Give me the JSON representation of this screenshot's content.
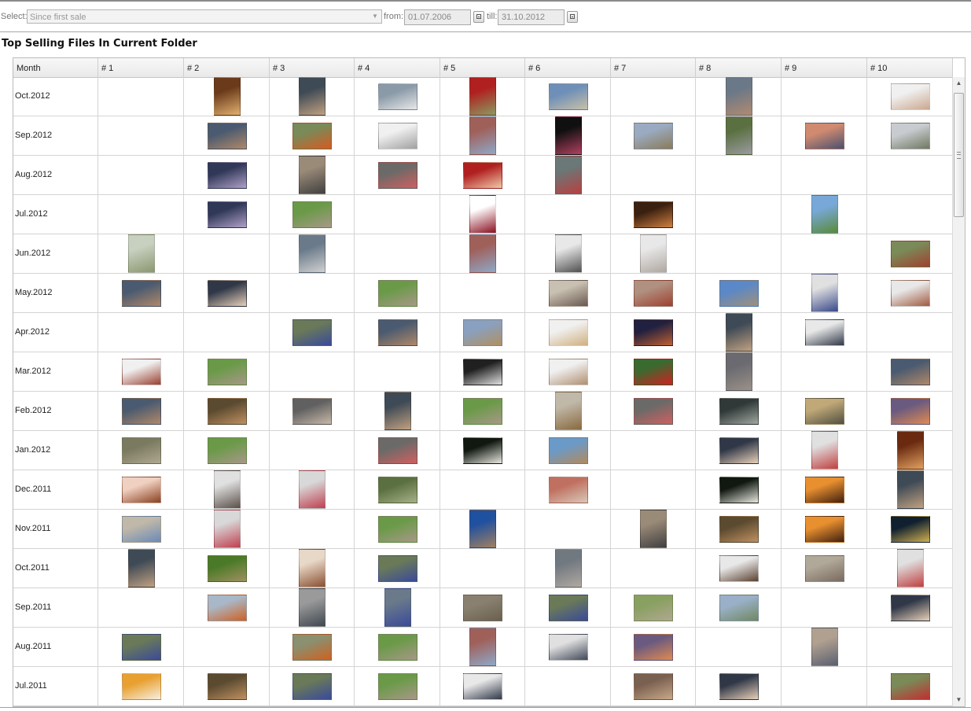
{
  "toolbar": {
    "select_label": "Select:",
    "period_value": "Since first sale",
    "from_label": "from:",
    "from_value": "01.07.2006",
    "till_label": "till:",
    "till_value": "31.10.2012"
  },
  "panel": {
    "title": "Top Selling Files In Current Folder"
  },
  "columns": [
    "Month",
    "# 1",
    "# 2",
    "# 3",
    "# 4",
    "# 5",
    "# 6",
    "# 7",
    "# 8",
    "# 9",
    "# 10"
  ],
  "rows": [
    {
      "month": "Oct.2012",
      "cells": [
        null,
        {
          "o": "p",
          "c": [
            "#6b3a1a",
            "#e0b070"
          ]
        },
        {
          "o": "p",
          "c": [
            "#3e4a55",
            "#c0a080"
          ]
        },
        {
          "o": "l",
          "c": [
            "#8a9aa8",
            "#e8e8e8"
          ]
        },
        {
          "o": "p",
          "c": [
            "#b02020",
            "#8a9a60"
          ]
        },
        {
          "o": "l",
          "c": [
            "#6e8fb8",
            "#c8c0a8"
          ]
        },
        null,
        {
          "o": "p",
          "c": [
            "#6a7888",
            "#b08a70"
          ]
        },
        null,
        {
          "o": "l",
          "c": [
            "#f0f0f0",
            "#caa890"
          ]
        }
      ]
    },
    {
      "month": "Sep.2012",
      "cells": [
        null,
        {
          "o": "l",
          "c": [
            "#4a5a70",
            "#b08868"
          ]
        },
        {
          "o": "l",
          "c": [
            "#7a8a58",
            "#d85a20"
          ]
        },
        {
          "o": "l",
          "c": [
            "#f0f0f0",
            "#a0a0a0"
          ]
        },
        {
          "o": "p",
          "c": [
            "#a0605a",
            "#8fa8c8"
          ]
        },
        {
          "o": "p",
          "c": [
            "#101010",
            "#b04060"
          ]
        },
        {
          "o": "l",
          "c": [
            "#9aaac0",
            "#8a7a58"
          ]
        },
        {
          "o": "p",
          "c": [
            "#5a7040",
            "#9a9aa0"
          ]
        },
        {
          "o": "l",
          "c": [
            "#d08a70",
            "#4a5070"
          ]
        },
        {
          "o": "l",
          "c": [
            "#c8ccd0",
            "#707860"
          ]
        }
      ]
    },
    {
      "month": "Aug.2012",
      "cells": [
        null,
        {
          "o": "l",
          "c": [
            "#303858",
            "#b0a0c8"
          ]
        },
        {
          "o": "p",
          "c": [
            "#9a8a78",
            "#404040"
          ]
        },
        {
          "o": "l",
          "c": [
            "#6a6a68",
            "#d06060"
          ]
        },
        {
          "o": "l",
          "c": [
            "#b02020",
            "#f0c8a8"
          ]
        },
        {
          "o": "p",
          "c": [
            "#6a7878",
            "#b84040"
          ]
        },
        null,
        null,
        null,
        null
      ]
    },
    {
      "month": "Jul.2012",
      "cells": [
        null,
        {
          "o": "l",
          "c": [
            "#303858",
            "#b0a0c8"
          ]
        },
        {
          "o": "l",
          "c": [
            "#6a9a48",
            "#a89888"
          ]
        },
        null,
        {
          "o": "p",
          "c": [
            "#ffffff",
            "#8a1020"
          ]
        },
        null,
        {
          "o": "l",
          "c": [
            "#3a2010",
            "#d08040"
          ]
        },
        null,
        {
          "o": "p",
          "c": [
            "#78a8d8",
            "#5a8a38"
          ]
        },
        null
      ]
    },
    {
      "month": "Jun.2012",
      "cells": [
        {
          "o": "p",
          "c": [
            "#c8d0c0",
            "#8a9870"
          ]
        },
        null,
        {
          "o": "p",
          "c": [
            "#6a7a8a",
            "#d0d0d0"
          ]
        },
        null,
        {
          "o": "p",
          "c": [
            "#a0605a",
            "#8fa8c8"
          ]
        },
        {
          "o": "p",
          "c": [
            "#e8e8e8",
            "#505050"
          ]
        },
        {
          "o": "p",
          "c": [
            "#e8e8e8",
            "#b0a8a0"
          ]
        },
        null,
        null,
        {
          "o": "l",
          "c": [
            "#7a8a58",
            "#a04030"
          ]
        }
      ]
    },
    {
      "month": "May.2012",
      "cells": [
        {
          "o": "l",
          "c": [
            "#4a5a70",
            "#b08868"
          ]
        },
        {
          "o": "l",
          "c": [
            "#303848",
            "#e8d0b8"
          ]
        },
        null,
        {
          "o": "l",
          "c": [
            "#6a9a48",
            "#a89888"
          ]
        },
        null,
        {
          "o": "l",
          "c": [
            "#c8c0b0",
            "#6a5850"
          ]
        },
        {
          "o": "l",
          "c": [
            "#b09080",
            "#a04030"
          ]
        },
        {
          "o": "l",
          "c": [
            "#5a88c8",
            "#a09078"
          ]
        },
        {
          "o": "p",
          "c": [
            "#e0e0e0",
            "#3a4a8a"
          ]
        },
        {
          "o": "l",
          "c": [
            "#e8e8e8",
            "#a05a40"
          ]
        }
      ]
    },
    {
      "month": "Apr.2012",
      "cells": [
        null,
        null,
        {
          "o": "l",
          "c": [
            "#6a7a58",
            "#3a4a9a"
          ]
        },
        {
          "o": "l",
          "c": [
            "#4a5a70",
            "#b08868"
          ]
        },
        {
          "o": "l",
          "c": [
            "#8aa0c0",
            "#b09060"
          ]
        },
        {
          "o": "l",
          "c": [
            "#f0f0f0",
            "#d0b080"
          ]
        },
        {
          "o": "l",
          "c": [
            "#202040",
            "#c06030"
          ]
        },
        {
          "o": "p",
          "c": [
            "#3e4a55",
            "#c0a080"
          ]
        },
        {
          "o": "l",
          "c": [
            "#e8e8e8",
            "#303848"
          ]
        },
        null
      ]
    },
    {
      "month": "Mar.2012",
      "cells": [
        {
          "o": "l",
          "c": [
            "#f0f0f0",
            "#9a4030"
          ]
        },
        {
          "o": "l",
          "c": [
            "#6a9a48",
            "#a89888"
          ]
        },
        null,
        null,
        {
          "o": "l",
          "c": [
            "#202020",
            "#e0e0e0"
          ]
        },
        {
          "o": "l",
          "c": [
            "#f0f0f0",
            "#b09070"
          ]
        },
        {
          "o": "l",
          "c": [
            "#3a6a30",
            "#d02020"
          ]
        },
        {
          "o": "p",
          "c": [
            "#6a6a70",
            "#9a9088"
          ]
        },
        null,
        {
          "o": "l",
          "c": [
            "#4a5a70",
            "#b08868"
          ]
        }
      ]
    },
    {
      "month": "Feb.2012",
      "cells": [
        {
          "o": "l",
          "c": [
            "#4a5a70",
            "#b08868"
          ]
        },
        {
          "o": "l",
          "c": [
            "#5a4a30",
            "#c09060"
          ]
        },
        {
          "o": "l",
          "c": [
            "#606060",
            "#c8b8a8"
          ]
        },
        {
          "o": "p",
          "c": [
            "#3e4a55",
            "#c0a080"
          ]
        },
        {
          "o": "l",
          "c": [
            "#6a9a48",
            "#a89888"
          ]
        },
        {
          "o": "p",
          "c": [
            "#c0b8a8",
            "#8a6a40"
          ]
        },
        {
          "o": "l",
          "c": [
            "#6a6a68",
            "#d06060"
          ]
        },
        {
          "o": "l",
          "c": [
            "#303838",
            "#a0a8a0"
          ]
        },
        {
          "o": "l",
          "c": [
            "#c0a878",
            "#505040"
          ]
        },
        {
          "o": "l",
          "c": [
            "#6a5a80",
            "#e08a50"
          ]
        }
      ]
    },
    {
      "month": "Jan.2012",
      "cells": [
        {
          "o": "l",
          "c": [
            "#7a7a60",
            "#b0a890"
          ]
        },
        {
          "o": "l",
          "c": [
            "#6a9a48",
            "#a89888"
          ]
        },
        null,
        {
          "o": "l",
          "c": [
            "#6a6a68",
            "#d06060"
          ]
        },
        {
          "o": "l",
          "c": [
            "#101810",
            "#e8e8e0"
          ]
        },
        {
          "o": "l",
          "c": [
            "#6a9ac8",
            "#b08a60"
          ]
        },
        null,
        {
          "o": "l",
          "c": [
            "#303848",
            "#e8d0b8"
          ]
        },
        {
          "o": "p",
          "c": [
            "#e0e0e0",
            "#c04040"
          ]
        },
        {
          "o": "p",
          "c": [
            "#6a2a10",
            "#e0a060"
          ]
        }
      ]
    },
    {
      "month": "Dec.2011",
      "cells": [
        {
          "o": "l",
          "c": [
            "#f0d0c0",
            "#8a4020"
          ]
        },
        {
          "o": "p",
          "c": [
            "#e0e0e0",
            "#5a5048"
          ]
        },
        {
          "o": "p",
          "c": [
            "#d8d8d8",
            "#c04050"
          ]
        },
        {
          "o": "l",
          "c": [
            "#5a7040",
            "#a8b088"
          ]
        },
        null,
        {
          "o": "l",
          "c": [
            "#c07060",
            "#d8c8b8"
          ]
        },
        null,
        {
          "o": "l",
          "c": [
            "#101810",
            "#e8e8e0"
          ]
        },
        {
          "o": "l",
          "c": [
            "#e89030",
            "#402010"
          ]
        },
        {
          "o": "p",
          "c": [
            "#3e4a55",
            "#c0a080"
          ]
        }
      ]
    },
    {
      "month": "Nov.2011",
      "cells": [
        {
          "o": "l",
          "c": [
            "#c0b8a8",
            "#6a8ab8"
          ]
        },
        {
          "o": "p",
          "c": [
            "#d8d8d8",
            "#c04050"
          ]
        },
        null,
        {
          "o": "l",
          "c": [
            "#6a9a48",
            "#a89888"
          ]
        },
        {
          "o": "p",
          "c": [
            "#2050a0",
            "#a08060"
          ]
        },
        null,
        {
          "o": "p",
          "c": [
            "#9a8a78",
            "#404040"
          ]
        },
        {
          "o": "l",
          "c": [
            "#5a4a30",
            "#c09060"
          ]
        },
        {
          "o": "l",
          "c": [
            "#e89030",
            "#402010"
          ]
        },
        {
          "o": "l",
          "c": [
            "#102030",
            "#d0b050"
          ]
        }
      ]
    },
    {
      "month": "Oct.2011",
      "cells": [
        {
          "o": "p",
          "c": [
            "#3e4a55",
            "#c0a080"
          ]
        },
        {
          "o": "l",
          "c": [
            "#4a7a28",
            "#a09060"
          ]
        },
        {
          "o": "p",
          "c": [
            "#e8d8c8",
            "#8a5030"
          ]
        },
        {
          "o": "l",
          "c": [
            "#6a7a58",
            "#3a4a9a"
          ]
        },
        null,
        {
          "o": "p",
          "c": [
            "#707880",
            "#b0a8a0"
          ]
        },
        null,
        {
          "o": "l",
          "c": [
            "#e8e8e8",
            "#5a4030"
          ]
        },
        {
          "o": "l",
          "c": [
            "#b0a898",
            "#7a6a60"
          ]
        },
        {
          "o": "p",
          "c": [
            "#e0e0e0",
            "#c04040"
          ]
        }
      ]
    },
    {
      "month": "Sep.2011",
      "cells": [
        null,
        {
          "o": "l",
          "c": [
            "#a8b8c8",
            "#d06020"
          ]
        },
        {
          "o": "p",
          "c": [
            "#9a9a9a",
            "#404850"
          ]
        },
        {
          "o": "p",
          "c": [
            "#6a7a8a",
            "#3a4a9a"
          ]
        },
        {
          "o": "l",
          "c": [
            "#8a8070",
            "#6a6050"
          ]
        },
        {
          "o": "l",
          "c": [
            "#6a7a58",
            "#3a4a9a"
          ]
        },
        {
          "o": "l",
          "c": [
            "#88a060",
            "#b0a890"
          ]
        },
        {
          "o": "l",
          "c": [
            "#9ab0c8",
            "#708860"
          ]
        },
        null,
        {
          "o": "l",
          "c": [
            "#303848",
            "#e8d0b8"
          ]
        }
      ]
    },
    {
      "month": "Aug.2011",
      "cells": [
        {
          "o": "l",
          "c": [
            "#6a7a58",
            "#3a4a9a"
          ]
        },
        null,
        {
          "o": "l",
          "c": [
            "#8a9070",
            "#d06020"
          ]
        },
        {
          "o": "l",
          "c": [
            "#6a9a48",
            "#a89888"
          ]
        },
        {
          "o": "p",
          "c": [
            "#a0605a",
            "#8fa8c8"
          ]
        },
        {
          "o": "l",
          "c": [
            "#e0e0e0",
            "#404858"
          ]
        },
        {
          "o": "l",
          "c": [
            "#6a5a80",
            "#e08a50"
          ]
        },
        null,
        {
          "o": "p",
          "c": [
            "#b0a090",
            "#5a6070"
          ]
        },
        null
      ]
    },
    {
      "month": "Jul.2011",
      "cells": [
        {
          "o": "l",
          "c": [
            "#e8a030",
            "#f8f0e0"
          ]
        },
        {
          "o": "l",
          "c": [
            "#5a4a30",
            "#c09060"
          ]
        },
        {
          "o": "l",
          "c": [
            "#6a7a58",
            "#3a4a9a"
          ]
        },
        {
          "o": "l",
          "c": [
            "#6a9a48",
            "#a89888"
          ]
        },
        {
          "o": "l",
          "c": [
            "#e8e8e8",
            "#303848"
          ]
        },
        null,
        {
          "o": "l",
          "c": [
            "#7a6050",
            "#c8a888"
          ]
        },
        {
          "o": "l",
          "c": [
            "#303848",
            "#e8d0b8"
          ]
        },
        null,
        {
          "o": "l",
          "c": [
            "#7a8a58",
            "#c03030"
          ]
        }
      ]
    }
  ]
}
